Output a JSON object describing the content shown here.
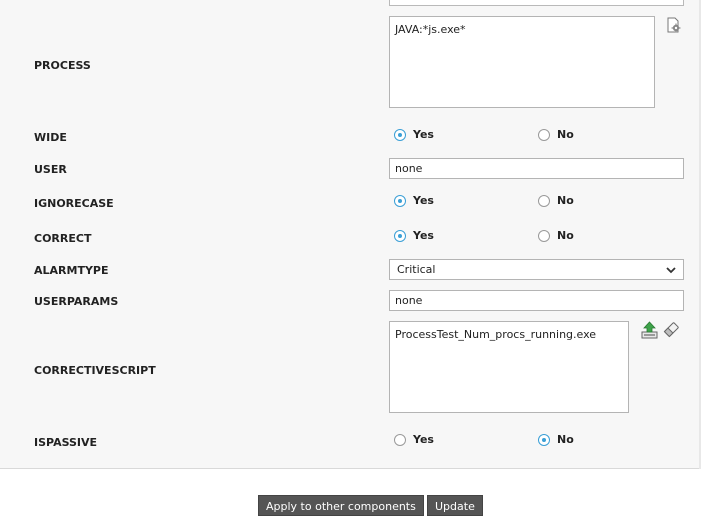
{
  "fields": {
    "process": {
      "label": "PROCESS",
      "value": "JAVA:*js.exe*"
    },
    "wide": {
      "label": "WIDE",
      "options": [
        "Yes",
        "No"
      ],
      "selected": "Yes"
    },
    "user": {
      "label": "USER",
      "value": "none"
    },
    "ignorecase": {
      "label": "IGNORECASE",
      "options": [
        "Yes",
        "No"
      ],
      "selected": "Yes"
    },
    "correct": {
      "label": "CORRECT",
      "options": [
        "Yes",
        "No"
      ],
      "selected": "Yes"
    },
    "alarmtype": {
      "label": "ALARMTYPE",
      "value": "Critical"
    },
    "userparams": {
      "label": "USERPARAMS",
      "value": "none"
    },
    "correctivescript": {
      "label": "CORRECTIVESCRIPT",
      "value": "ProcessTest_Num_procs_running.exe"
    },
    "ispassive": {
      "label": "ISPASSIVE",
      "options": [
        "Yes",
        "No"
      ],
      "selected": "No"
    }
  },
  "icons": {
    "process_settings": "gear-document-icon",
    "upload": "upload-icon",
    "clear": "eraser-icon"
  },
  "buttons": {
    "apply_label": "Apply to other components",
    "update_label": "Update"
  },
  "colors": {
    "radio_accent": "#3a9fd6",
    "button_bg": "#555555"
  }
}
